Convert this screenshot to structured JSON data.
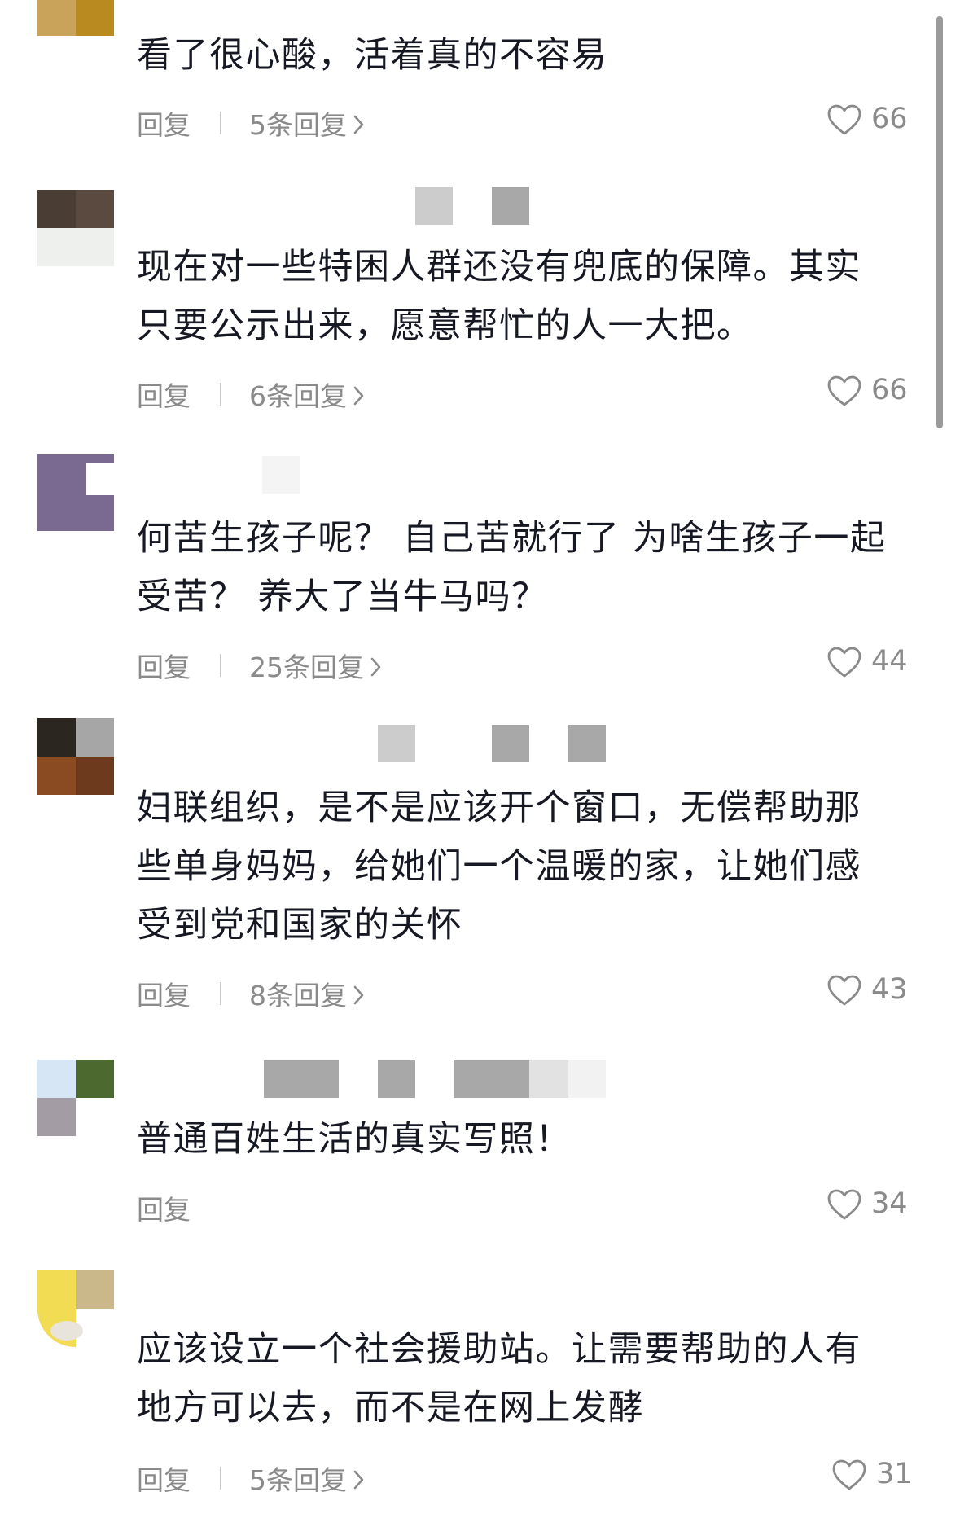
{
  "comments": [
    {
      "text": "看了很心酸，活着真的不容易",
      "reply_label": "回复",
      "replies_label": "5条回复",
      "likes": "66"
    },
    {
      "text": "现在对一些特困人群还没有兜底的保障。其实\n只要公示出来，愿意帮忙的人一大把。",
      "reply_label": "回复",
      "replies_label": "6条回复",
      "likes": "66"
    },
    {
      "text": "何苦生孩子呢？ 自己苦就行了 为啥生孩子一起\n受苦？ 养大了当牛马吗？",
      "reply_label": "回复",
      "replies_label": "25条回复",
      "likes": "44"
    },
    {
      "text": "妇联组织，是不是应该开个窗口，无偿帮助那\n些单身妈妈，给她们一个温暖的家，让她们感\n受到党和国家的关怀",
      "reply_label": "回复",
      "replies_label": "8条回复",
      "likes": "43"
    },
    {
      "text": "普通百姓生活的真实写照！",
      "reply_label": "回复",
      "likes": "34"
    },
    {
      "text": "应该设立一个社会援助站。让需要帮助的人有\n地方可以去，而不是在网上发酵",
      "reply_label": "回复",
      "replies_label": "5条回复",
      "likes": "31"
    }
  ],
  "icons": {
    "like": "heart-outline-icon",
    "expand": "chevron-right-icon"
  },
  "colors": {
    "text": "#161823",
    "secondary": "#8a8a8a",
    "background": "#ffffff"
  }
}
